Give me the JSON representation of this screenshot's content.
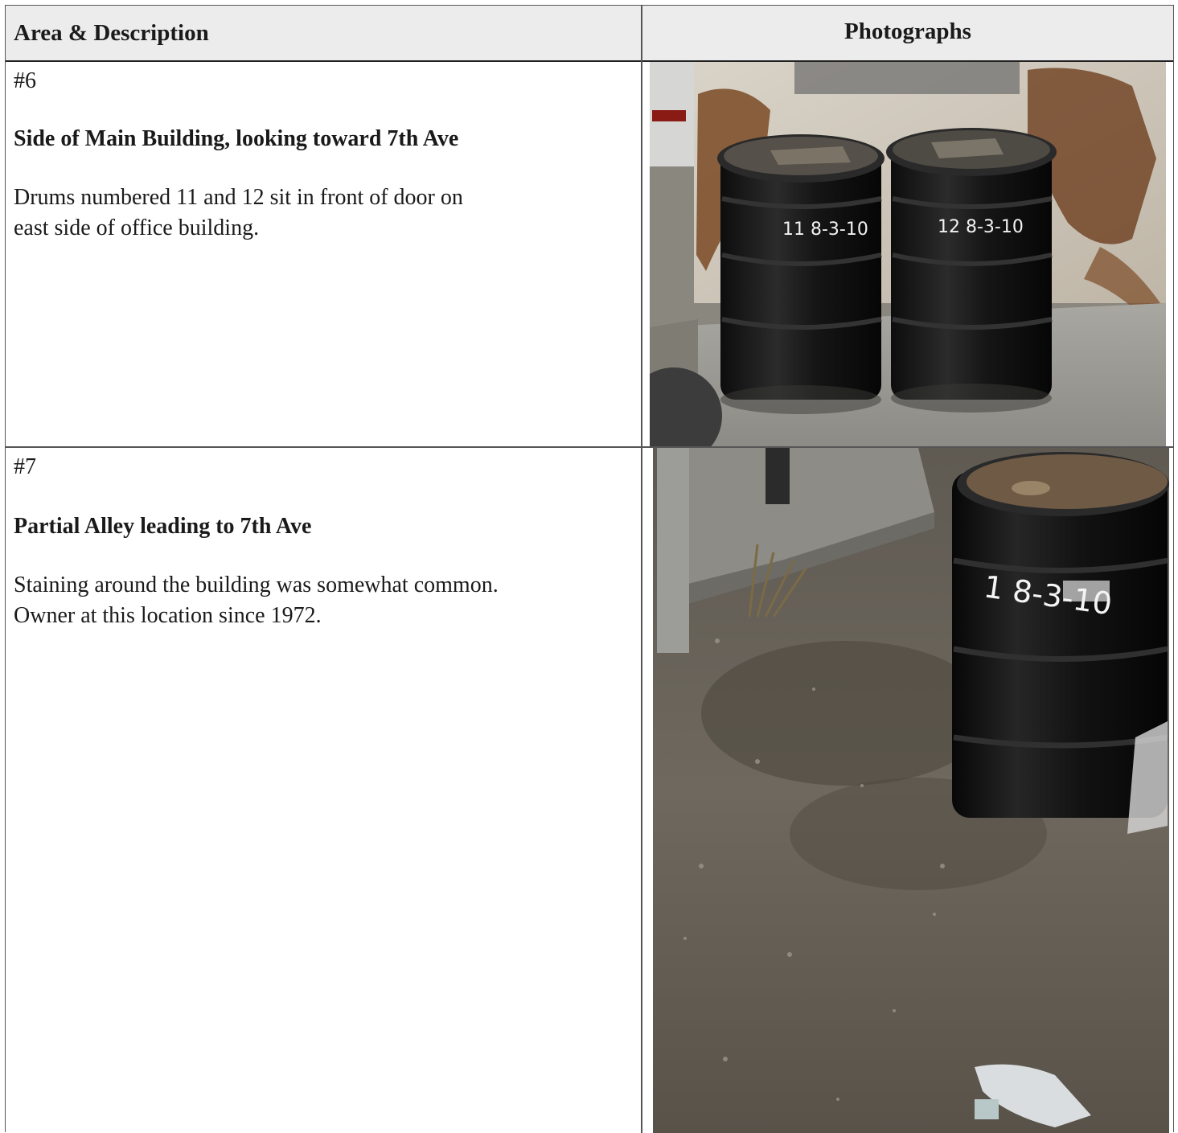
{
  "header": {
    "left": "Area & Description",
    "right": "Photographs"
  },
  "rows": [
    {
      "number": "#6",
      "title": "Side of Main Building, looking toward 7th Ave",
      "description_lines": [
        "Drums numbered 11 and 12 sit in front of door on",
        "east side of office building."
      ],
      "photo_labels": [
        "11 8-3-10",
        "12 8-3-10"
      ]
    },
    {
      "number": "#7",
      "title": "Partial Alley leading to 7th Ave",
      "description_lines": [
        "Staining around the building was somewhat common.",
        "Owner at this location since 1972."
      ],
      "photo_labels": [
        "1 8-3-10"
      ]
    }
  ]
}
